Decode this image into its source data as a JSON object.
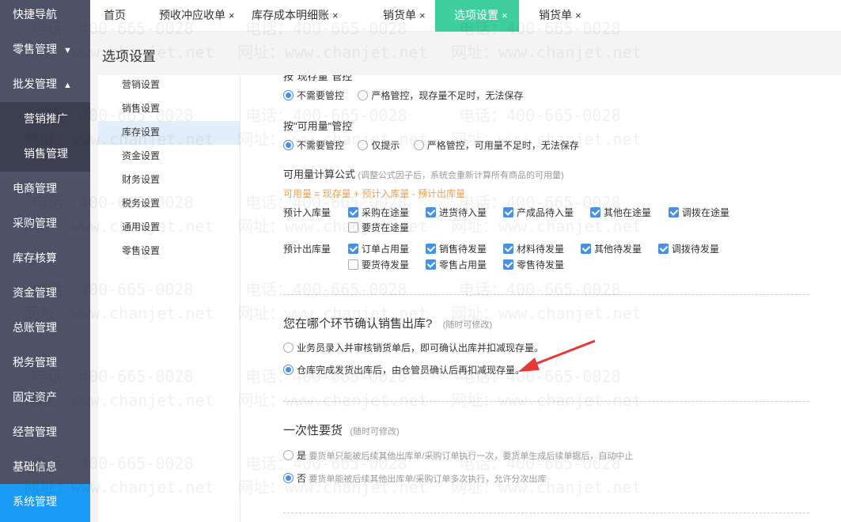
{
  "sidebar": {
    "items": [
      {
        "label": "快捷导航"
      },
      {
        "label": "零售管理",
        "arrow": "▼"
      },
      {
        "label": "批发管理",
        "arrow": "▲"
      },
      {
        "label": "营销推广"
      },
      {
        "label": "销售管理"
      },
      {
        "label": "电商管理"
      },
      {
        "label": "采购管理"
      },
      {
        "label": "库存核算"
      },
      {
        "label": "资金管理"
      },
      {
        "label": "总账管理"
      },
      {
        "label": "税务管理"
      },
      {
        "label": "固定资产"
      },
      {
        "label": "经营管理"
      },
      {
        "label": "基础信息"
      },
      {
        "label": "系统管理"
      }
    ],
    "active_color": "#1a9bf5"
  },
  "tabs": [
    {
      "label": "首页"
    },
    {
      "label": "预收冲应收单",
      "close": "×"
    },
    {
      "label": "库存成本明细账",
      "close": "×"
    },
    {
      "label": "销货单",
      "close": "×"
    },
    {
      "label": "选项设置",
      "close": "×"
    },
    {
      "label": "销货单",
      "close": "×"
    }
  ],
  "tab_active_color": "#3ecf9f",
  "header": {
    "title": "选项设置"
  },
  "left_menu": [
    "营销设置",
    "销售设置",
    "库存设置",
    "资金设置",
    "财务设置",
    "税务设置",
    "通用设置",
    "零售设置"
  ],
  "content": {
    "stock_control": {
      "title": "按\"现存量\"管控",
      "options": [
        "不需要管控",
        "严格管控，现存量不足时，无法保存"
      ]
    },
    "available_control": {
      "title": "按\"可用量\"管控",
      "options": [
        "不需要管控",
        "仅提示",
        "严格管控，可用量不足时，无法保存"
      ]
    },
    "formula": {
      "title": "可用量计算公式",
      "note": "(调整公式因子后，系统会重新计算所有商品的可用量)",
      "expression": "可用量 = 现存量 + 预计入库量 - 预计出库量",
      "color": "#f0a050"
    },
    "inbound": {
      "label": "预计入库量",
      "items": [
        {
          "label": "采购在途量",
          "checked": true
        },
        {
          "label": "进货待入量",
          "checked": true
        },
        {
          "label": "产成品待入量",
          "checked": true
        },
        {
          "label": "其他在途量",
          "checked": true
        },
        {
          "label": "调拨在途量",
          "checked": true
        },
        {
          "label": "要货在途量",
          "checked": false
        }
      ]
    },
    "outbound": {
      "label": "预计出库量",
      "items": [
        {
          "label": "订单占用量",
          "checked": true
        },
        {
          "label": "销售待发量",
          "checked": true
        },
        {
          "label": "材料待发量",
          "checked": true
        },
        {
          "label": "其他待发量",
          "checked": true
        },
        {
          "label": "调拨待发量",
          "checked": true
        },
        {
          "label": "要货待发量",
          "checked": false
        },
        {
          "label": "零售占用量",
          "checked": true
        },
        {
          "label": "零售待发量",
          "checked": true
        }
      ]
    },
    "confirm_outbound": {
      "title": "您在哪个环节确认销售出库?",
      "note": "(随时可修改)",
      "options": [
        "业务员录入并审核销货单后，即可确认出库并扣减现存量。",
        "仓库完成发货出库后，由仓管员确认后再扣减现存量。"
      ]
    },
    "one_time": {
      "title": "一次性要货",
      "note": "(随时可修改)",
      "options": [
        {
          "label": "是",
          "desc": "要货单只能被后续其他出库单/采购订单执行一次，要货单生成后续单据后，自动中止"
        },
        {
          "label": "否",
          "desc": "要货单能被后续其他出库单/采购订单多次执行，允许分次出库"
        }
      ]
    }
  },
  "watermark": {
    "phone": "电话：400-665-0028",
    "site": "网址：www.chanjet.net"
  },
  "annotation_arrow_color": "#e53935"
}
